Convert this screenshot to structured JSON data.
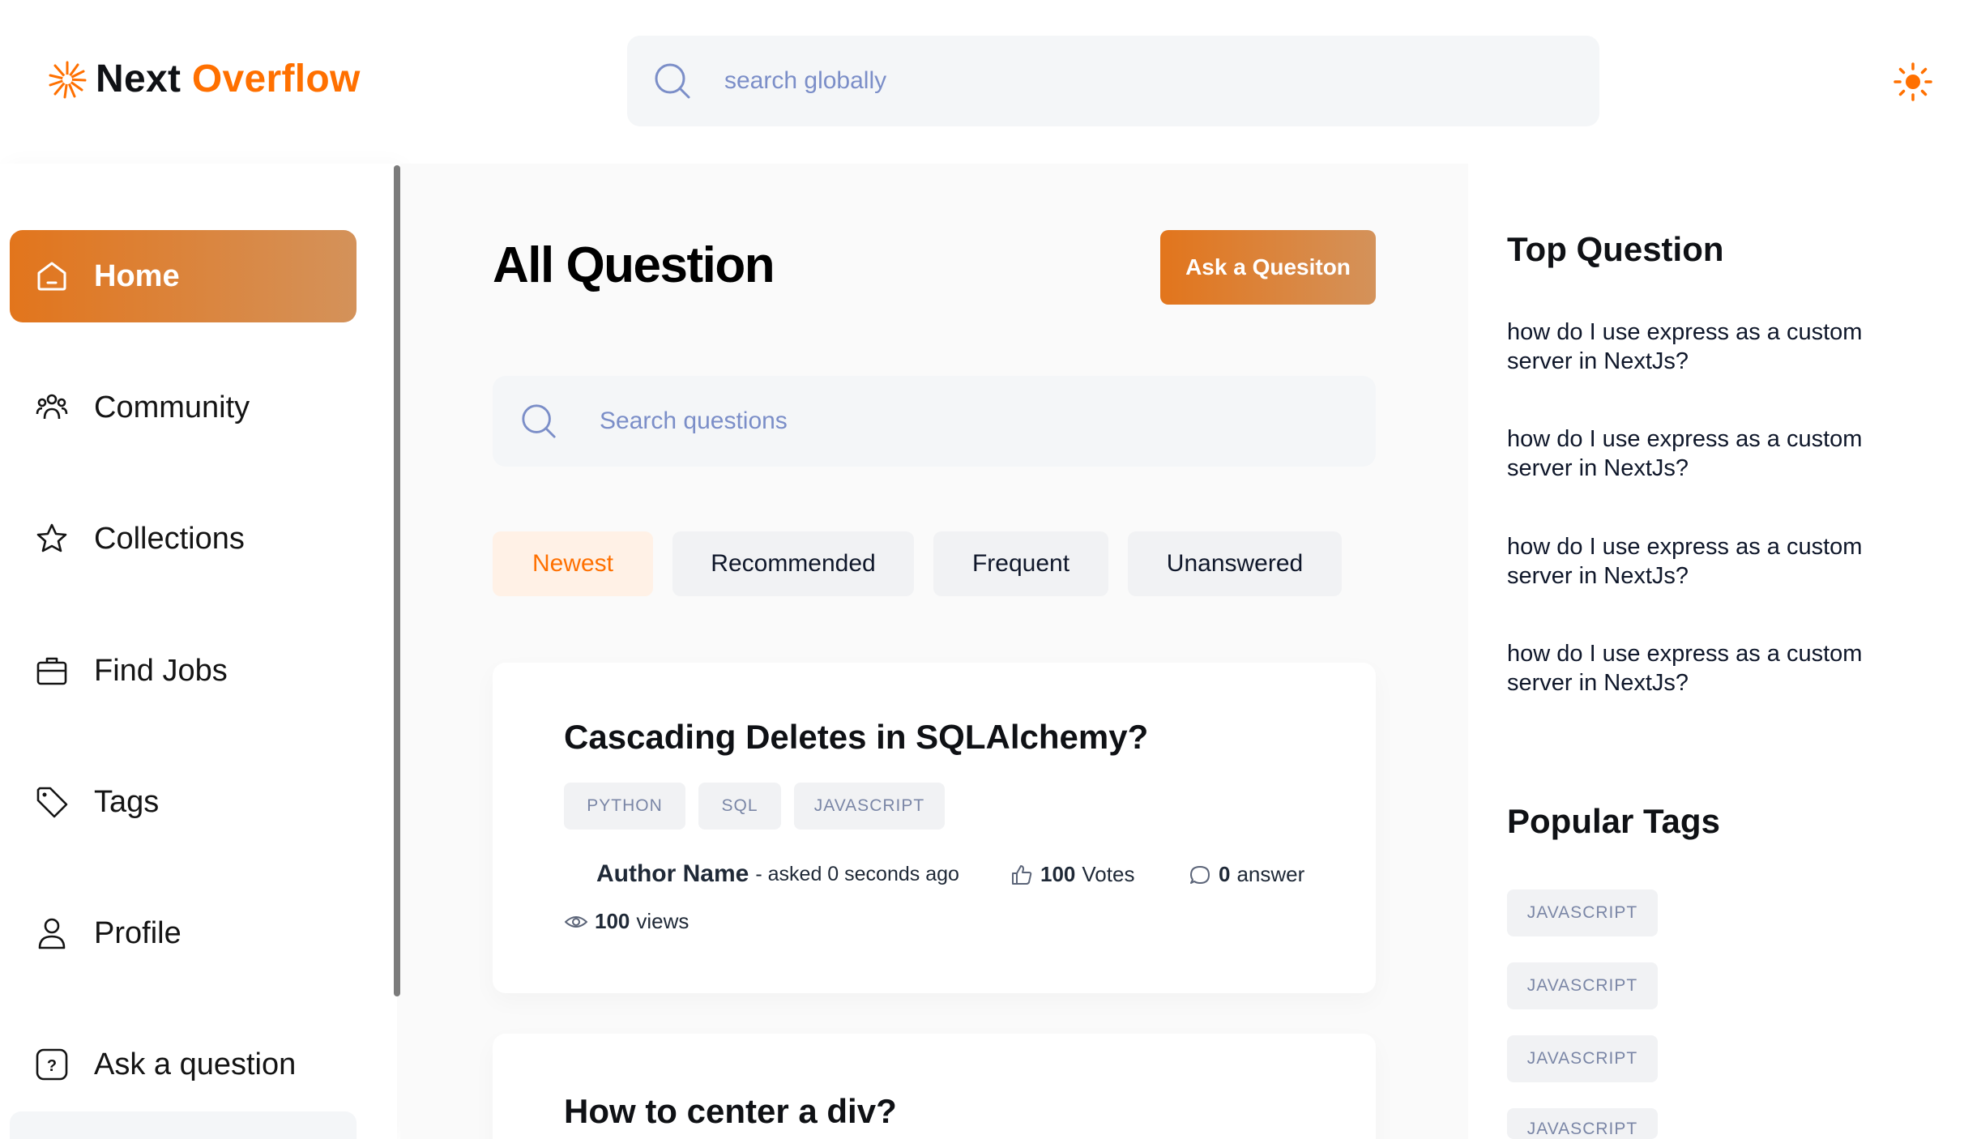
{
  "brand": {
    "name_part1": "Next",
    "name_part2": "Overflow",
    "accent": "#ff7000"
  },
  "header": {
    "search_placeholder": "search globally",
    "search_icon": "search-icon",
    "theme_icon": "sun-icon"
  },
  "sidebar": {
    "items": [
      {
        "label": "Home",
        "icon": "home-icon",
        "active": true
      },
      {
        "label": "Community",
        "icon": "users-icon",
        "active": false
      },
      {
        "label": "Collections",
        "icon": "star-icon",
        "active": false
      },
      {
        "label": "Find Jobs",
        "icon": "briefcase-icon",
        "active": false
      },
      {
        "label": "Tags",
        "icon": "tag-icon",
        "active": false
      },
      {
        "label": "Profile",
        "icon": "user-icon",
        "active": false
      },
      {
        "label": "Ask a question",
        "icon": "question-icon",
        "active": false
      }
    ]
  },
  "main": {
    "title": "All Question",
    "ask_button": "Ask a Quesiton",
    "search_placeholder": "Search questions",
    "filters": [
      "Newest",
      "Recommended",
      "Frequent",
      "Unanswered"
    ],
    "active_filter": "Newest",
    "questions": [
      {
        "title": "Cascading Deletes in SQLAlchemy?",
        "tags": [
          "PYTHON",
          "SQL",
          "JAVASCRIPT"
        ],
        "author": "Author Name",
        "asked": "- asked 0 seconds ago",
        "votes_value": "100",
        "votes_label": "Votes",
        "answers_value": "0",
        "answers_label": "answer",
        "views_value": "100",
        "views_label": "views"
      },
      {
        "title": "How to center a div?"
      }
    ]
  },
  "right": {
    "top_heading": "Top Question",
    "top_questions": [
      "how do I use express as a custom server in NextJs?",
      "how do I use express as a custom server in NextJs?",
      "how do I use express as a custom server in NextJs?",
      "how do I use express as a custom server in NextJs?"
    ],
    "tags_heading": "Popular Tags",
    "popular_tags": [
      "JAVASCRIPT",
      "JAVASCRIPT",
      "JAVASCRIPT",
      "JAVASCRIPT"
    ]
  }
}
